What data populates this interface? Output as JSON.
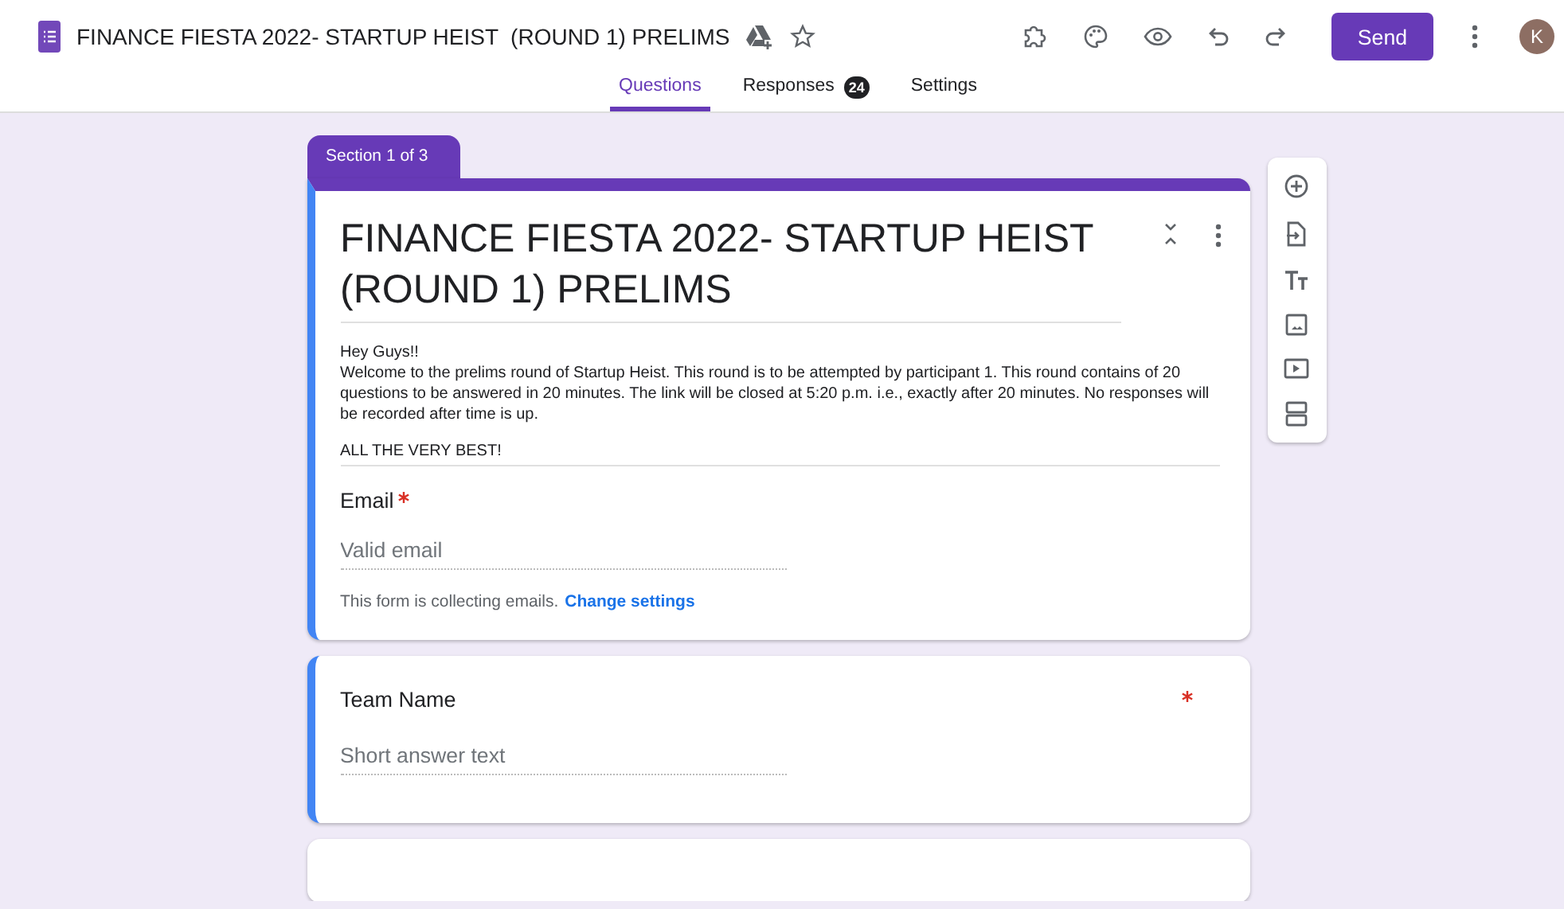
{
  "app": {
    "title": "FINANCE FIESTA 2022- STARTUP HEIST  (ROUND 1) PRELIMS",
    "send": "Send",
    "avatar": "K"
  },
  "tabs": [
    {
      "label": "Questions",
      "selected": true
    },
    {
      "label": "Responses",
      "selected": false,
      "badge": "24"
    },
    {
      "label": "Settings",
      "selected": false
    }
  ],
  "section": {
    "label": "Section 1 of 3",
    "title": "FINANCE FIESTA 2022- STARTUP HEIST (ROUND 1) PRELIMS",
    "description": [
      "Hey Guys!!",
      "Welcome to the prelims round of Startup Heist. This round is to be attempted by participant 1. This round contains of 20 questions to be answered in 20 minutes. The link will be closed at 5:20 p.m. i.e., exactly after 20 minutes. No responses will be recorded after time is up.",
      "ALL THE VERY BEST!"
    ]
  },
  "questions": [
    {
      "kind": "email",
      "title": "Email",
      "required": true,
      "placeholder": "Valid email",
      "note": "This form is collecting emails.",
      "link": "Change settings"
    },
    {
      "kind": "short",
      "title": "Team Name",
      "required": true,
      "placeholder": "Short answer text"
    }
  ]
}
